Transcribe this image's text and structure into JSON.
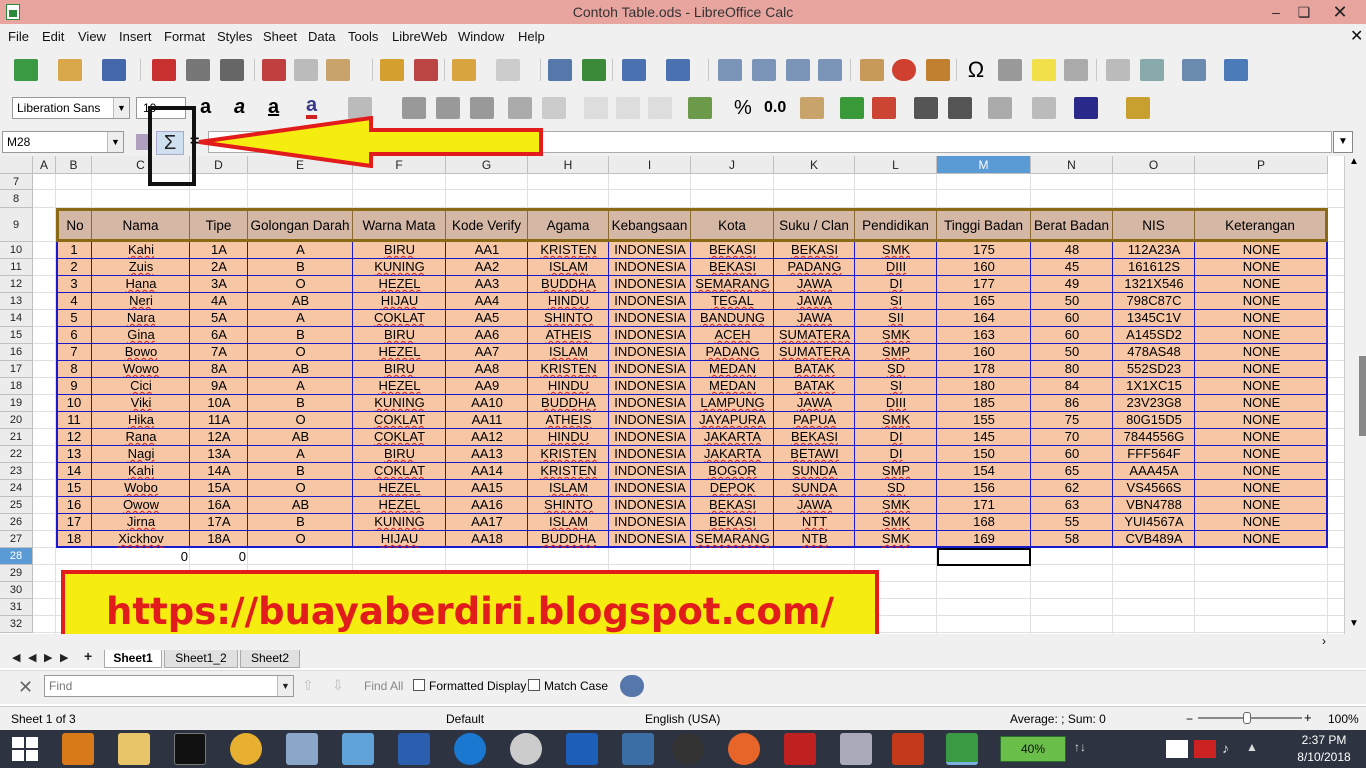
{
  "window": {
    "title": "Contoh Table.ods - LibreOffice Calc"
  },
  "menu": [
    "File",
    "Edit",
    "View",
    "Insert",
    "Format",
    "Styles",
    "Sheet",
    "Data",
    "Tools",
    "LibreWeb",
    "Window",
    "Help"
  ],
  "toolbar": {
    "font_name": "Liberation Sans",
    "font_size": "10",
    "currency": "%",
    "decimal": "0.0"
  },
  "formula_bar": {
    "name_box": "M28",
    "sigma": "Σ",
    "equals": "="
  },
  "columns": [
    "A",
    "B",
    "C",
    "D",
    "E",
    "F",
    "G",
    "H",
    "I",
    "J",
    "K",
    "L",
    "M",
    "N",
    "O",
    "P"
  ],
  "selected_column": "M",
  "row_numbers": [
    "7",
    "8",
    "9",
    "10",
    "11",
    "12",
    "13",
    "14",
    "15",
    "16",
    "17",
    "18",
    "19",
    "20",
    "21",
    "22",
    "23",
    "24",
    "25",
    "26",
    "27",
    "28",
    "29",
    "30",
    "31",
    "32"
  ],
  "selected_row": "28",
  "table": {
    "headers": [
      "No",
      "Nama",
      "Tipe",
      "Golongan Darah",
      "Warna Mata",
      "Kode Verify",
      "Agama",
      "Kebangsaan",
      "Kota",
      "Suku / Clan",
      "Pendidikan",
      "Tinggi Badan",
      "Berat Badan",
      "NIS",
      "Keterangan"
    ],
    "rows": [
      [
        "1",
        "Kahi",
        "1A",
        "A",
        "BIRU",
        "AA1",
        "KRISTEN",
        "INDONESIA",
        "BEKASI",
        "BEKASI",
        "SMK",
        "175",
        "48",
        "112A23A",
        "NONE"
      ],
      [
        "2",
        "Zuis",
        "2A",
        "B",
        "KUNING",
        "AA2",
        "ISLAM",
        "INDONESIA",
        "BEKASI",
        "PADANG",
        "DIII",
        "160",
        "45",
        "161612S",
        "NONE"
      ],
      [
        "3",
        "Hana",
        "3A",
        "O",
        "HEZEL",
        "AA3",
        "BUDDHA",
        "INDONESIA",
        "SEMARANG",
        "JAWA",
        "DI",
        "177",
        "49",
        "1321X546",
        "NONE"
      ],
      [
        "4",
        "Neri",
        "4A",
        "AB",
        "HIJAU",
        "AA4",
        "HINDU",
        "INDONESIA",
        "TEGAL",
        "JAWA",
        "SI",
        "165",
        "50",
        "798C87C",
        "NONE"
      ],
      [
        "5",
        "Nara",
        "5A",
        "A",
        "COKLAT",
        "AA5",
        "SHINTO",
        "INDONESIA",
        "BANDUNG",
        "JAWA",
        "SII",
        "164",
        "60",
        "1345C1V",
        "NONE"
      ],
      [
        "6",
        "Gina",
        "6A",
        "B",
        "BIRU",
        "AA6",
        "ATHEIS",
        "INDONESIA",
        "ACEH",
        "SUMATERA",
        "SMK",
        "163",
        "60",
        "A145SD2",
        "NONE"
      ],
      [
        "7",
        "Bowo",
        "7A",
        "O",
        "HEZEL",
        "AA7",
        "ISLAM",
        "INDONESIA",
        "PADANG",
        "SUMATERA",
        "SMP",
        "160",
        "50",
        "478AS48",
        "NONE"
      ],
      [
        "8",
        "Wowo",
        "8A",
        "AB",
        "BIRU",
        "AA8",
        "KRISTEN",
        "INDONESIA",
        "MEDAN",
        "BATAK",
        "SD",
        "178",
        "80",
        "552SD23",
        "NONE"
      ],
      [
        "9",
        "Cici",
        "9A",
        "A",
        "HEZEL",
        "AA9",
        "HINDU",
        "INDONESIA",
        "MEDAN",
        "BATAK",
        "SI",
        "180",
        "84",
        "1X1XC15",
        "NONE"
      ],
      [
        "10",
        "Viki",
        "10A",
        "B",
        "KUNING",
        "AA10",
        "BUDDHA",
        "INDONESIA",
        "LAMPUNG",
        "JAWA",
        "DIII",
        "185",
        "86",
        "23V23G8",
        "NONE"
      ],
      [
        "11",
        "Hika",
        "11A",
        "O",
        "COKLAT",
        "AA11",
        "ATHEIS",
        "INDONESIA",
        "JAYAPURA",
        "PAPUA",
        "SMK",
        "155",
        "75",
        "80G15D5",
        "NONE"
      ],
      [
        "12",
        "Rana",
        "12A",
        "AB",
        "COKLAT",
        "AA12",
        "HINDU",
        "INDONESIA",
        "JAKARTA",
        "BEKASI",
        "DI",
        "145",
        "70",
        "7844556G",
        "NONE"
      ],
      [
        "13",
        "Nagi",
        "13A",
        "A",
        "BIRU",
        "AA13",
        "KRISTEN",
        "INDONESIA",
        "JAKARTA",
        "BETAWI",
        "DI",
        "150",
        "60",
        "FFF564F",
        "NONE"
      ],
      [
        "14",
        "Kahi",
        "14A",
        "B",
        "COKLAT",
        "AA14",
        "KRISTEN",
        "INDONESIA",
        "BOGOR",
        "SUNDA",
        "SMP",
        "154",
        "65",
        "AAA45A",
        "NONE"
      ],
      [
        "15",
        "Wobo",
        "15A",
        "O",
        "HEZEL",
        "AA15",
        "ISLAM",
        "INDONESIA",
        "DEPOK",
        "SUNDA",
        "SD",
        "156",
        "62",
        "VS4566S",
        "NONE"
      ],
      [
        "16",
        "Owow",
        "16A",
        "AB",
        "HEZEL",
        "AA16",
        "SHINTO",
        "INDONESIA",
        "BEKASI",
        "JAWA",
        "SMK",
        "171",
        "63",
        "VBN4788",
        "NONE"
      ],
      [
        "17",
        "Jirna",
        "17A",
        "B",
        "KUNING",
        "AA17",
        "ISLAM",
        "INDONESIA",
        "BEKASI",
        "NTT",
        "SMK",
        "168",
        "55",
        "YUI4567A",
        "NONE"
      ],
      [
        "18",
        "Xickhov",
        "18A",
        "O",
        "HIJAU",
        "AA18",
        "BUDDHA",
        "INDONESIA",
        "SEMARANG",
        "NTB",
        "SMK",
        "169",
        "58",
        "CVB489A",
        "NONE"
      ]
    ],
    "row28": {
      "c": "0",
      "d": "0"
    }
  },
  "banner": "https://buayaberdiri.blogspot.com/",
  "tabs": [
    "Sheet1",
    "Sheet1_2",
    "Sheet2"
  ],
  "find": {
    "placeholder": "Find",
    "find_all": "Find All",
    "formatted_display": "Formatted Display",
    "match_case": "Match Case"
  },
  "status": {
    "sheet": "Sheet 1 of 3",
    "style": "Default",
    "language": "English (USA)",
    "sum": "Average: ; Sum: 0",
    "zoom": "100%"
  },
  "taskbar": {
    "time": "2:37 PM",
    "date": "8/10/2018",
    "battery": "40%"
  }
}
